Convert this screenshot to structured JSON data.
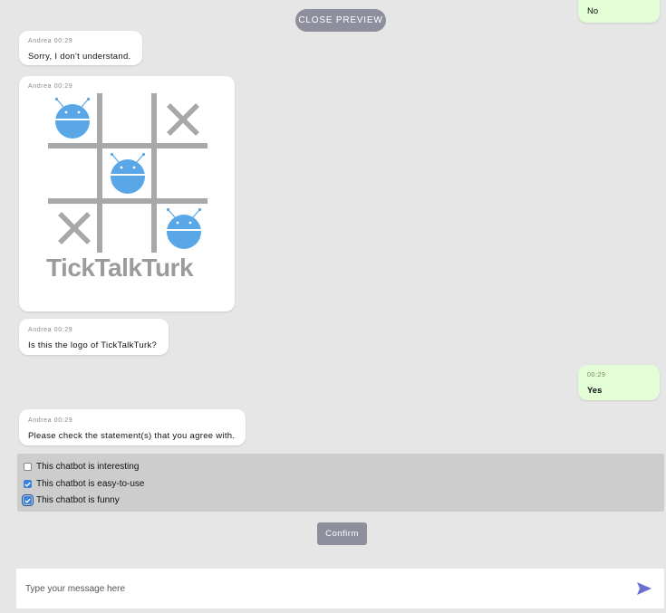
{
  "header": {
    "close_preview_label": "CLOSE PREVIEW"
  },
  "messages": [
    {
      "type": "out",
      "text": "No"
    },
    {
      "type": "in",
      "sender": "Andrea",
      "time": "00:29",
      "text": "Sorry, I don't understand."
    },
    {
      "type": "image",
      "sender": "Andrea",
      "time": "00:29",
      "logo_text": "TickTalkTurk"
    },
    {
      "type": "in",
      "sender": "Andrea",
      "time": "00:29",
      "text": "Is this the logo of TickTalkTurk?"
    },
    {
      "type": "out",
      "time": "00:29",
      "text": "Yes"
    },
    {
      "type": "in",
      "sender": "Andrea",
      "time": "00:29",
      "text": "Please check the statement(s) that you agree with."
    }
  ],
  "checklist": {
    "options": [
      {
        "label": "This chatbot is interesting",
        "checked": false
      },
      {
        "label": "This chatbot is easy-to-use",
        "checked": true
      },
      {
        "label": "This chatbot is funny",
        "checked": true
      }
    ],
    "confirm_label": "Confirm"
  },
  "composer": {
    "placeholder": "Type your message here",
    "send_icon": "send-icon"
  },
  "colors": {
    "background": "#e6e6e6",
    "incoming_bubble": "#ffffff",
    "outgoing_bubble": "#e3fdd6",
    "accent_button": "#8e8f9c",
    "robot_blue": "#5aa7e8",
    "grid_gray": "#a8a8a8",
    "send_icon": "#6a6fd0",
    "checkbox_blue": "#3b82d8"
  }
}
